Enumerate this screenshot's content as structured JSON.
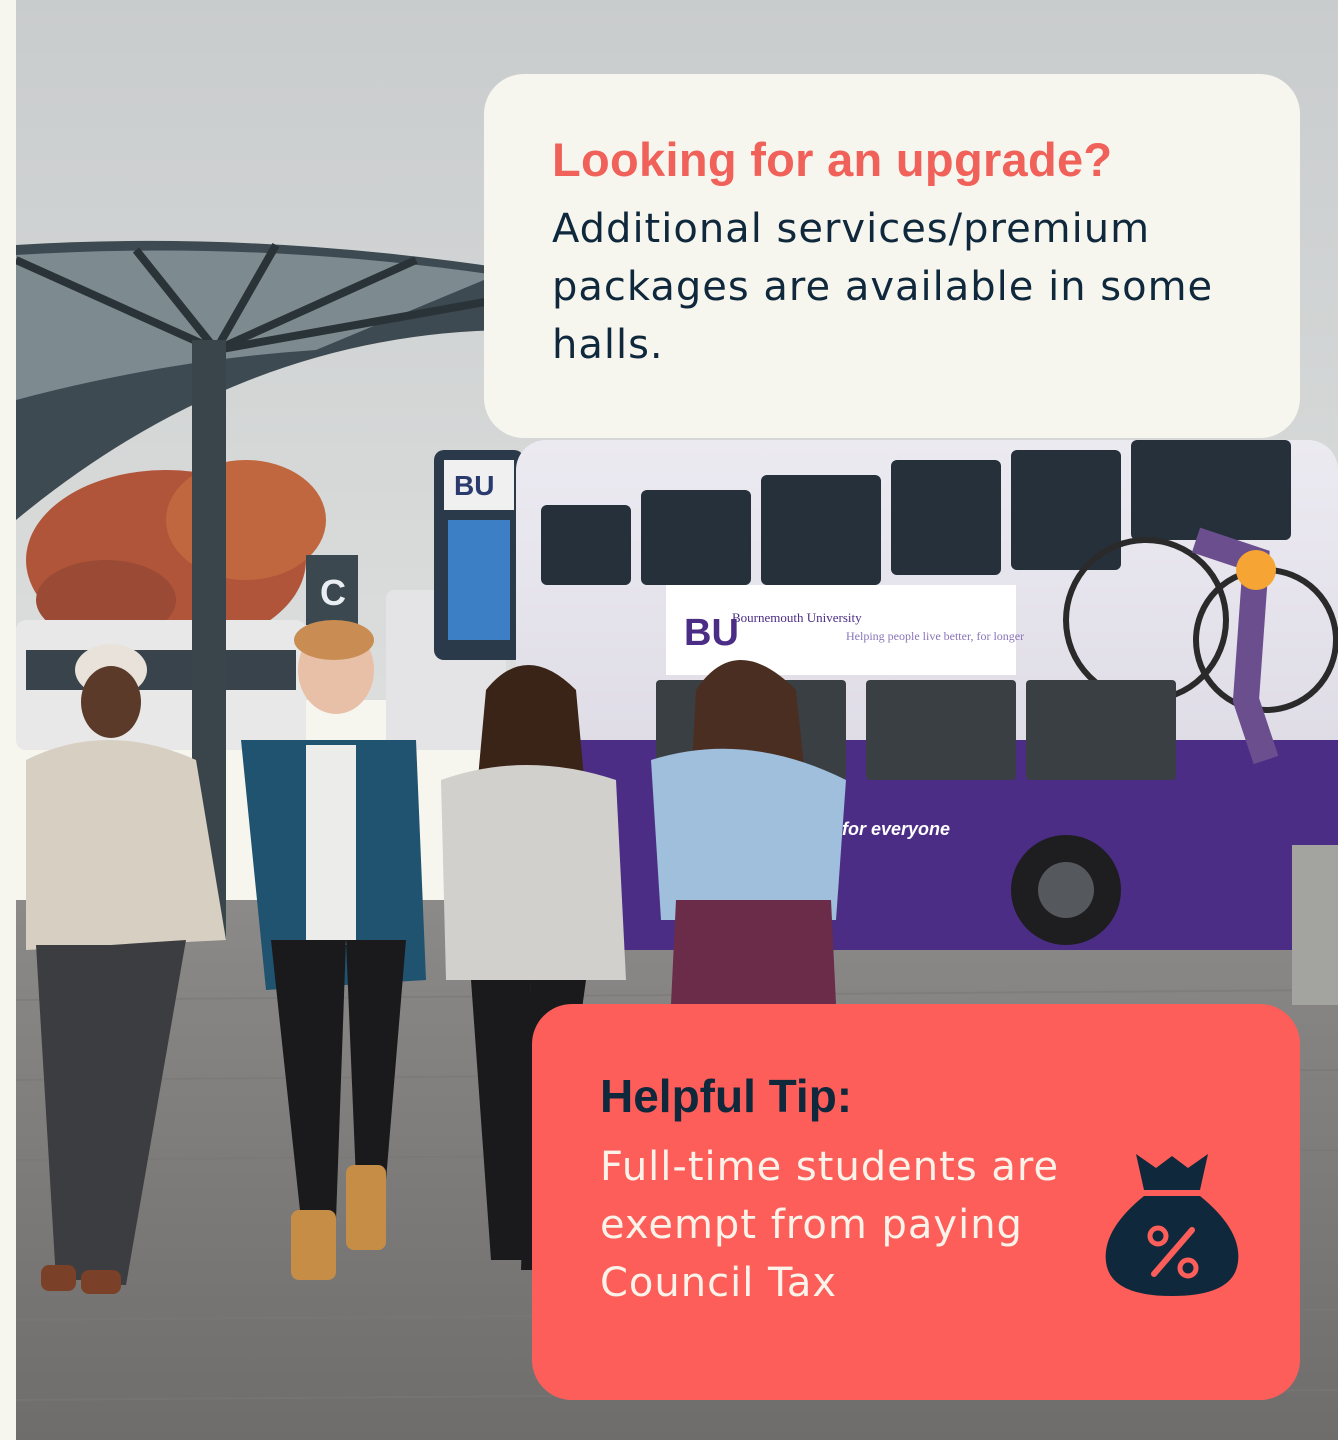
{
  "upgrade_card": {
    "heading": "Looking for an upgrade?",
    "body": "Additional services/premium packages are available in some halls."
  },
  "tip_card": {
    "heading": "Helpful Tip:",
    "body": "Full-time students are exempt from paying Council Tax",
    "icon": "money-bag-percent-icon"
  },
  "photo": {
    "bus_logo": "BU",
    "bus_name": "Bournemouth University",
    "bus_tagline": "Helping people live better, for longer",
    "bus_side_text": "for everyone",
    "stop_letter": "C"
  },
  "colors": {
    "background": "#f6f6ef",
    "accent_coral": "#fd5e59",
    "heading_coral": "#f0615a",
    "navy": "#10283c",
    "bus_purple": "#4b2d86"
  }
}
